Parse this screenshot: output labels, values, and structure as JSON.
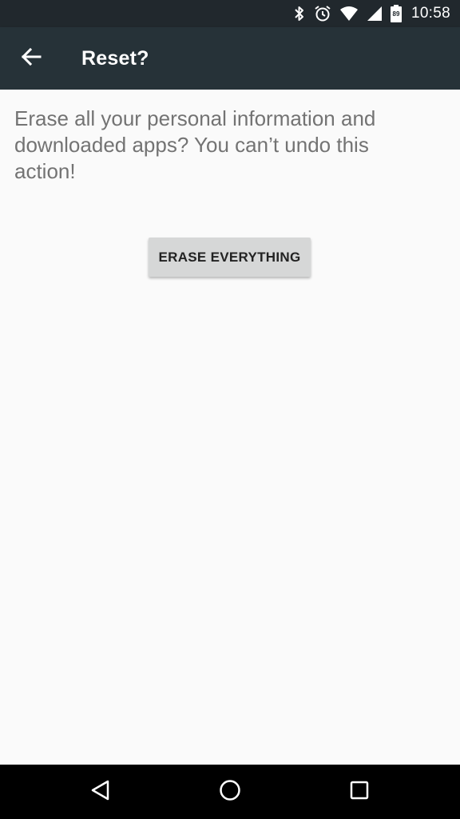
{
  "status_bar": {
    "time": "10:58",
    "battery_level": "89",
    "icons": [
      "bluetooth-icon",
      "alarm-icon",
      "wifi-icon",
      "cell-signal-icon",
      "battery-icon"
    ]
  },
  "toolbar": {
    "title": "Reset?",
    "back_icon": "arrow-left-icon"
  },
  "main": {
    "message": "Erase all your personal information and downloaded apps? You can’t undo this action!",
    "erase_button_label": "ERASE EVERYTHING"
  },
  "nav_bar": {
    "buttons": [
      "back-triangle-icon",
      "home-circle-icon",
      "recents-square-icon"
    ]
  },
  "colors": {
    "status_bar": "#21282d",
    "toolbar": "#263238",
    "background": "#fafafa",
    "button": "#d6d7d7",
    "text": "#737373"
  }
}
